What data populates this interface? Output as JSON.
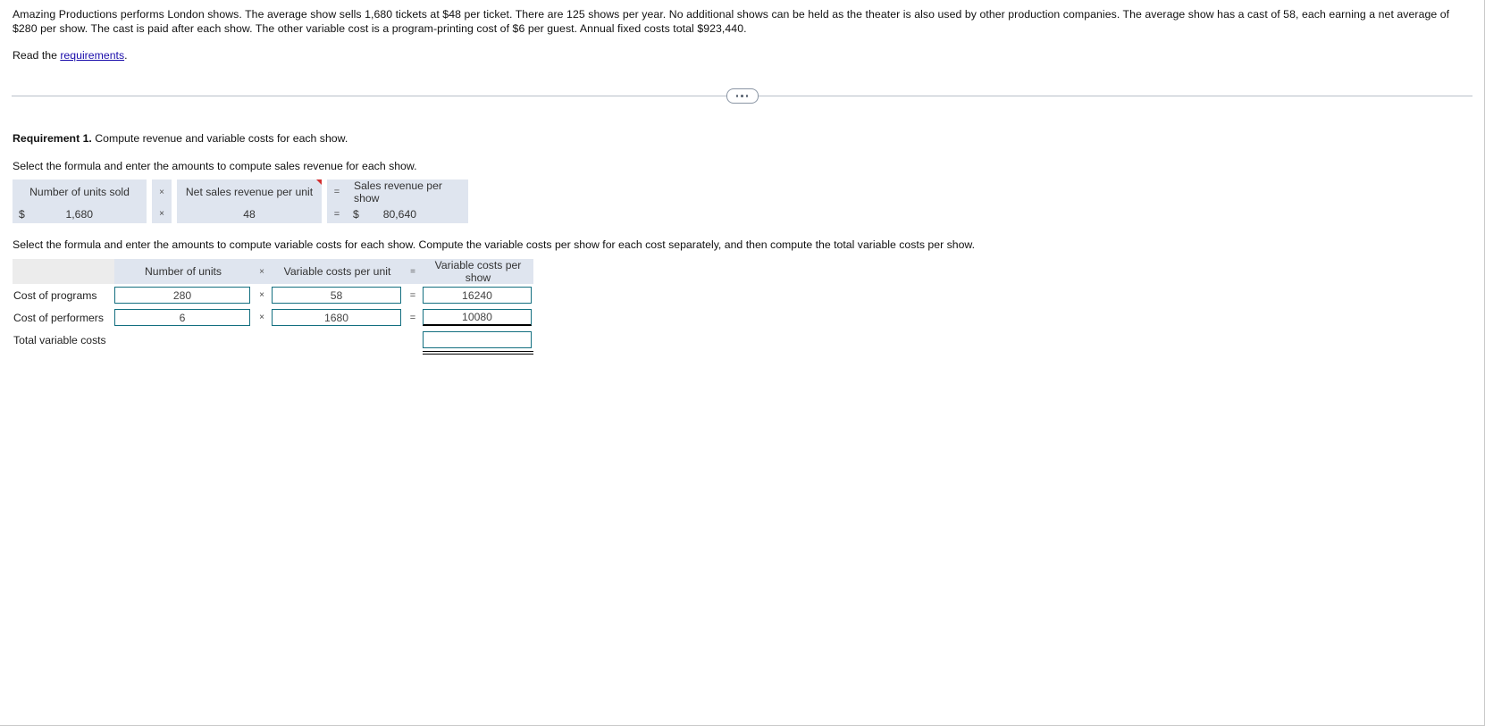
{
  "problem": {
    "text": "Amazing Productions performs London shows. The average show sells 1,680 tickets at $48 per ticket. There are 125 shows per year. No additional shows can be held as the theater is also used by other production companies. The average show has a cast of 58, each earning a net average of $280 per show. The cast is paid after each show. The other variable cost is a program-printing cost of $6 per guest. Annual fixed costs total $923,440.",
    "read_prefix": "Read the ",
    "read_link": "requirements",
    "read_suffix": "."
  },
  "divider": {
    "dots_label": "..."
  },
  "requirement": {
    "label": "Requirement 1.",
    "title": " Compute revenue and variable costs for each show.",
    "instruction_1": "Select the formula and enter the amounts to compute sales revenue for each show.",
    "instruction_2": "Select the formula and enter the amounts to compute variable costs for each show. Compute the variable costs per show for each cost separately, and then compute the total variable costs per show."
  },
  "sales_table": {
    "headers": {
      "units": "Number of units sold",
      "op_times": "×",
      "per_unit": "Net sales revenue per unit",
      "op_equals": "=",
      "result": "Sales revenue per show"
    },
    "row": {
      "currency_left": "$",
      "units_value": "1,680",
      "op_times": "×",
      "per_unit_value": "48",
      "op_equals": "=",
      "currency_right": "$",
      "result_value": "80,640"
    }
  },
  "variable_table": {
    "headers": {
      "blank": "",
      "units": "Number of units",
      "op_times": "×",
      "per_unit": "Variable costs per unit",
      "op_equals": "=",
      "result": "Variable costs per show"
    },
    "rows": [
      {
        "label": "Cost of programs",
        "units_value": "280",
        "op_times": "×",
        "per_unit_value": "58",
        "op_equals": "=",
        "result_value": "16240"
      },
      {
        "label": "Cost of performers",
        "units_value": "6",
        "op_times": "×",
        "per_unit_value": "1680",
        "op_equals": "=",
        "result_value": "10080"
      }
    ],
    "total_row": {
      "label": "Total variable costs",
      "total_value": ""
    }
  },
  "colors": {
    "header_blue": "#dfe5ef",
    "header_gray": "#ececec",
    "input_border": "#136f80",
    "link": "#1a0dab",
    "comment_flag": "#d32f2f"
  }
}
